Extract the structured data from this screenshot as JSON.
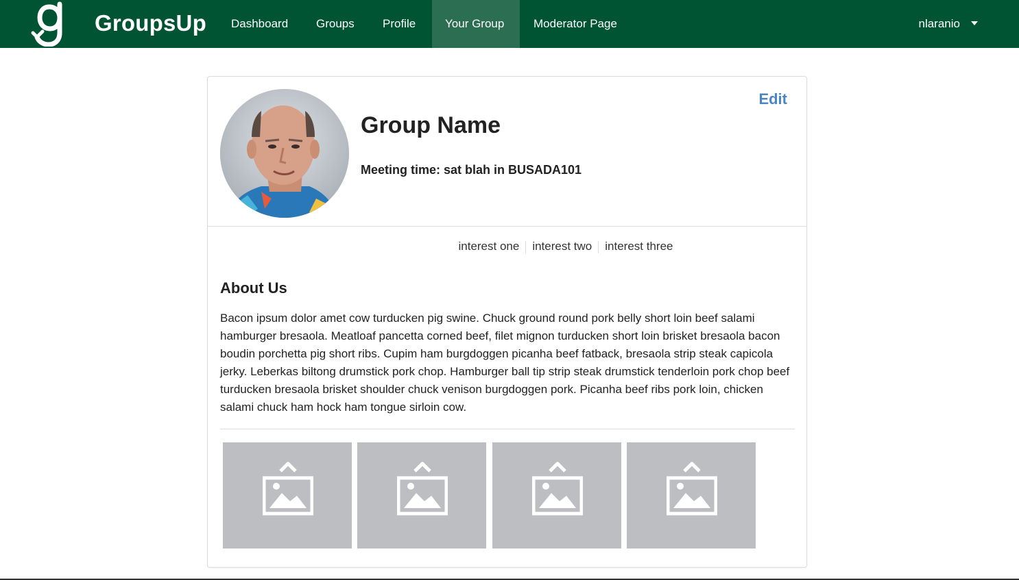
{
  "navbar": {
    "brand": "GroupsUp",
    "items": [
      {
        "label": "Dashboard"
      },
      {
        "label": "Groups"
      },
      {
        "label": "Profile"
      },
      {
        "label": "Your Group"
      },
      {
        "label": "Moderator Page"
      }
    ],
    "active_item": "Your Group",
    "username": "nlaranio",
    "colors": {
      "bar": "#005333",
      "active": "#2b6e51"
    }
  },
  "group": {
    "name": "Group Name",
    "meeting": "Meeting time: sat blah in BUSADA101",
    "edit_label": "Edit",
    "interests": [
      "interest one",
      "interest two",
      "interest three"
    ],
    "about_title": "About Us",
    "about_text": "Bacon ipsum dolor amet cow turducken pig swine. Chuck ground round pork belly short loin beef salami hamburger bresaola. Meatloaf pancetta corned beef, filet mignon turducken short loin brisket bresaola bacon boudin porchetta pig short ribs. Cupim ham burgdoggen picanha beef fatback, bresaola strip steak capicola jerky. Leberkas biltong drumstick pork chop. Hamburger ball tip strip steak drumstick tenderloin pork chop beef turducken bresaola brisket shoulder chuck venison burgdoggen pork. Picanha beef ribs pork loin, chicken salami chuck ham hock ham tongue sirloin cow.",
    "gallery": [
      {
        "icon": "image-placeholder-icon"
      },
      {
        "icon": "image-placeholder-icon"
      },
      {
        "icon": "image-placeholder-icon"
      },
      {
        "icon": "image-placeholder-icon"
      }
    ]
  }
}
